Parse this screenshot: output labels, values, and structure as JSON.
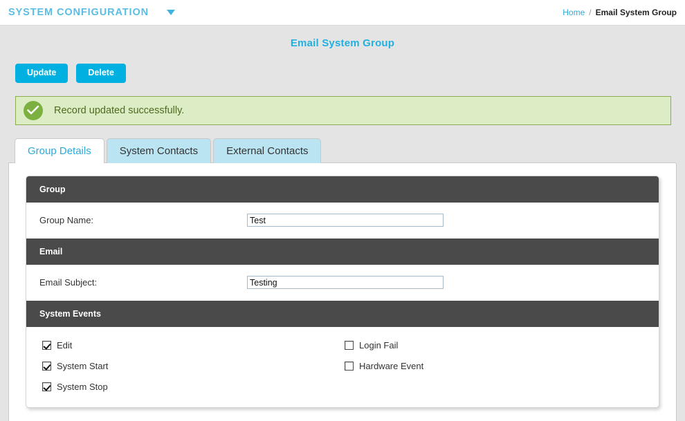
{
  "topbar": {
    "app_title": "SYSTEM CONFIGURATION",
    "menu_caret_icon": "chevron-down-icon",
    "breadcrumb": {
      "home_label": "Home",
      "separator": "/",
      "current_label": "Email System Group"
    }
  },
  "page": {
    "title": "Email System Group"
  },
  "toolbar": {
    "update_label": "Update",
    "delete_label": "Delete"
  },
  "alert": {
    "icon": "check-circle-icon",
    "message": "Record updated successfully.",
    "background_color": "#dcecc4",
    "border_color": "#8aab4f",
    "icon_color": "#7cb041",
    "text_color": "#4f6a20"
  },
  "tabs": [
    {
      "label": "Group Details",
      "active": true
    },
    {
      "label": "System Contacts",
      "active": false
    },
    {
      "label": "External Contacts",
      "active": false
    }
  ],
  "sections": {
    "group": {
      "header": "Group",
      "group_name_label": "Group Name:",
      "group_name_value": "Test",
      "group_name_placeholder": ""
    },
    "email": {
      "header": "Email",
      "email_subject_label": "Email Subject:",
      "email_subject_value": "Testing",
      "email_subject_placeholder": ""
    },
    "system_events": {
      "header": "System Events",
      "left_column": [
        {
          "label": "Edit",
          "checked": true
        },
        {
          "label": "System Start",
          "checked": true
        },
        {
          "label": "System Stop",
          "checked": true
        }
      ],
      "right_column": [
        {
          "label": "Login Fail",
          "checked": false
        },
        {
          "label": "Hardware Event",
          "checked": false
        }
      ]
    }
  },
  "colors": {
    "accent": "#00b0e1",
    "title_accent": "#22b0e0",
    "page_background": "#e4e4e4",
    "section_header": "#4a4a4a",
    "tab_inactive": "#bbe4f2"
  }
}
